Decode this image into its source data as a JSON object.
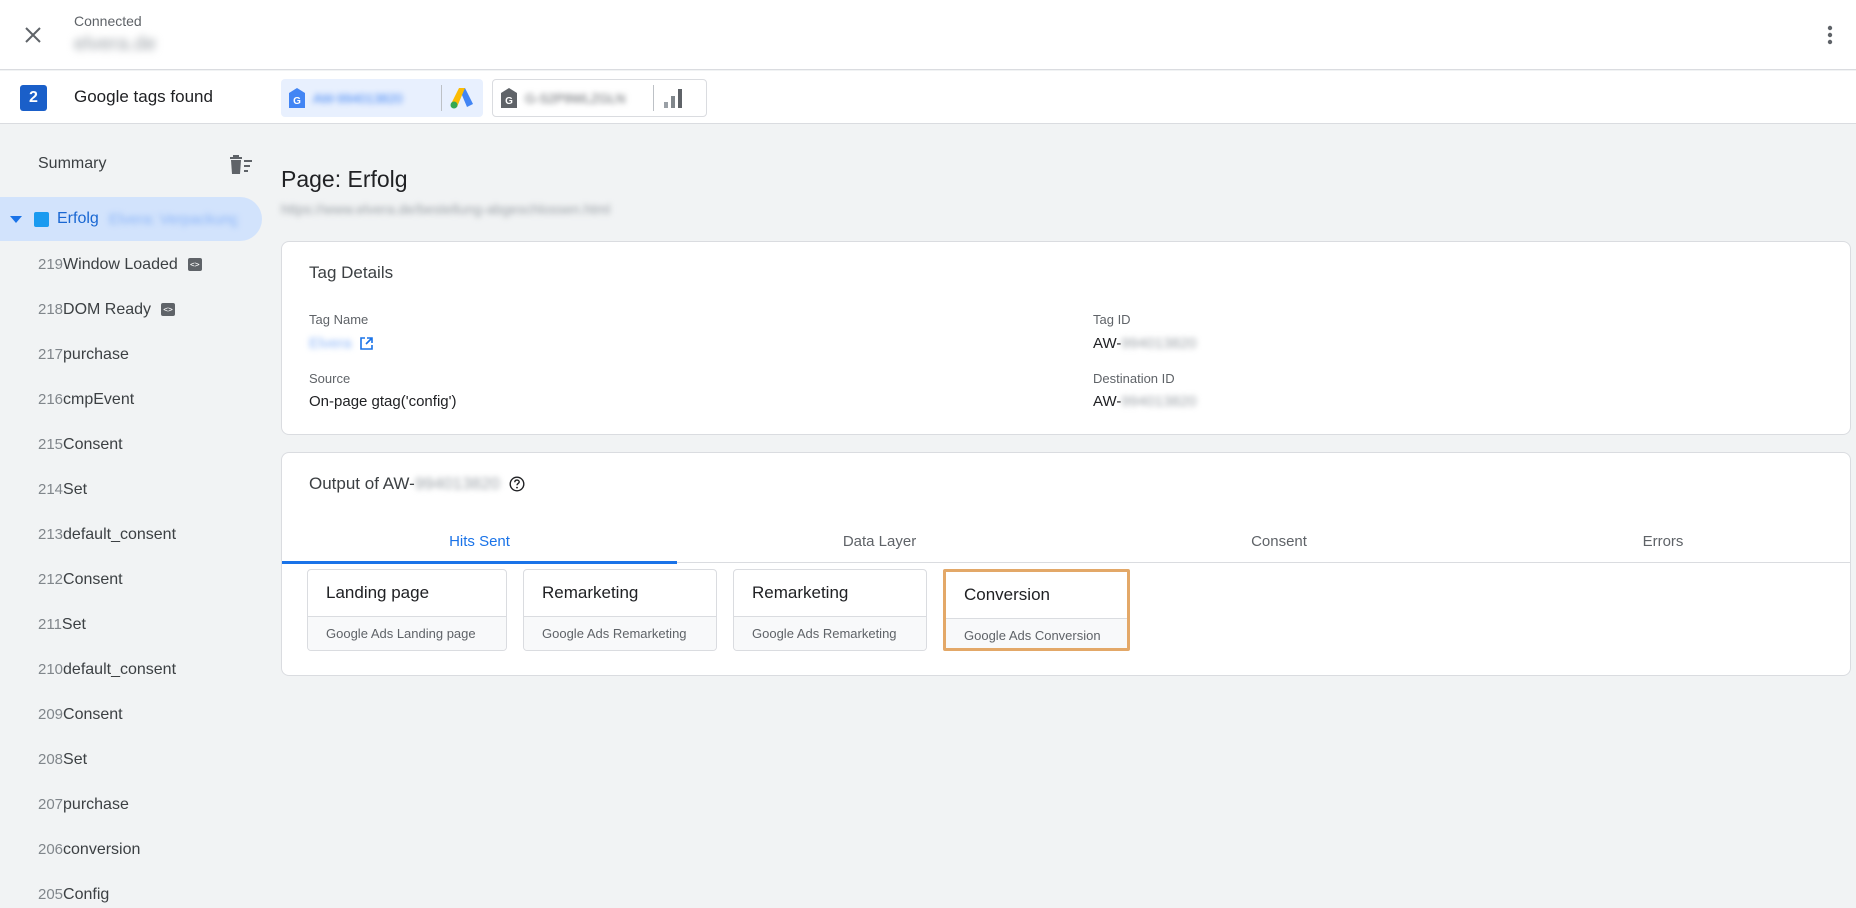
{
  "header": {
    "status": "Connected",
    "domain": "elvera.de"
  },
  "tags_bar": {
    "count": "2",
    "label": "Google tags found",
    "chips": [
      {
        "id": "AW-994013820",
        "product": "google-ads-icon",
        "active": true
      },
      {
        "id": "G-S2P9WLZGLN",
        "product": "google-analytics-icon",
        "active": false
      }
    ]
  },
  "sidebar": {
    "summary_label": "Summary",
    "page": {
      "name": "Erfolg",
      "title": "Elvera: Verpackung"
    },
    "events": [
      {
        "num": "219",
        "label": "Window Loaded",
        "icon": true
      },
      {
        "num": "218",
        "label": "DOM Ready",
        "icon": true
      },
      {
        "num": "217",
        "label": "purchase",
        "icon": false
      },
      {
        "num": "216",
        "label": "cmpEvent",
        "icon": false
      },
      {
        "num": "215",
        "label": "Consent",
        "icon": false
      },
      {
        "num": "214",
        "label": "Set",
        "icon": false
      },
      {
        "num": "213",
        "label": "default_consent",
        "icon": false
      },
      {
        "num": "212",
        "label": "Consent",
        "icon": false
      },
      {
        "num": "211",
        "label": "Set",
        "icon": false
      },
      {
        "num": "210",
        "label": "default_consent",
        "icon": false
      },
      {
        "num": "209",
        "label": "Consent",
        "icon": false
      },
      {
        "num": "208",
        "label": "Set",
        "icon": false
      },
      {
        "num": "207",
        "label": "purchase",
        "icon": false
      },
      {
        "num": "206",
        "label": "conversion",
        "icon": false
      },
      {
        "num": "205",
        "label": "Config",
        "icon": false
      }
    ]
  },
  "main": {
    "page_title": "Page: Erfolg",
    "page_url": "https://www.elvera.de/bestellung-abgeschlossen.html",
    "tag_details": {
      "title": "Tag Details",
      "tag_name_label": "Tag Name",
      "tag_name_value": "Elvera",
      "tag_id_label": "Tag ID",
      "tag_id_prefix": "AW-",
      "tag_id_rest": "994013820",
      "source_label": "Source",
      "source_value": "On-page gtag('config')",
      "dest_label": "Destination ID",
      "dest_prefix": "AW-",
      "dest_rest": "994013820"
    },
    "output": {
      "title_prefix": "Output of AW-",
      "title_rest": "994013820",
      "tabs": [
        "Hits Sent",
        "Data Layer",
        "Consent",
        "Errors"
      ],
      "active_tab": "Hits Sent",
      "hits": [
        {
          "name": "Landing page",
          "type": "Google Ads Landing page"
        },
        {
          "name": "Remarketing",
          "type": "Google Ads Remarketing"
        },
        {
          "name": "Remarketing",
          "type": "Google Ads Remarketing"
        },
        {
          "name": "Conversion",
          "type": "Google Ads Conversion"
        }
      ]
    }
  }
}
